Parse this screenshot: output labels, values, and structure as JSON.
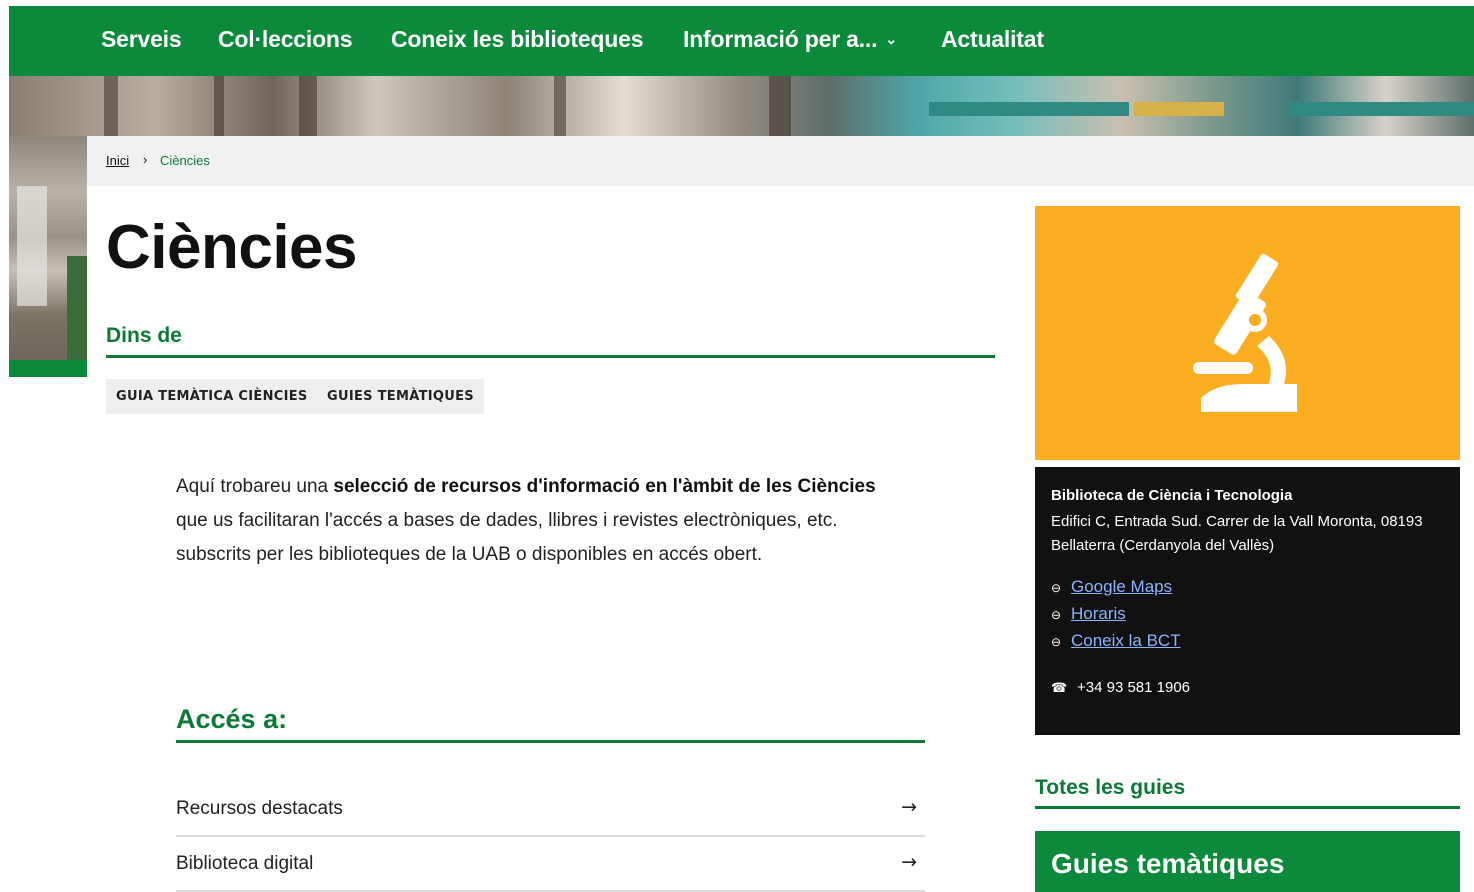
{
  "nav": {
    "items": [
      {
        "label": "Serveis"
      },
      {
        "label": "Col·leccions"
      },
      {
        "label": "Coneix les biblioteques"
      },
      {
        "label": "Informació per a..."
      },
      {
        "label": "Actualitat"
      }
    ],
    "dropdown_icon": "chevron-down-icon"
  },
  "breadcrumb": {
    "home": "Inici",
    "separator": "›",
    "current": "Ciències"
  },
  "page": {
    "title": "Ciències",
    "dins_de": "Dins de",
    "tags": [
      "GUIA TEMÀTICA CIÈNCIES",
      "GUIES TEMÀTIQUES"
    ]
  },
  "intro": {
    "part1": "Aquí trobareu una ",
    "bold1": "selecció de recursos d'informació en l'àmbit de les Ciències",
    "part2": " que us facilitaran l'accés a bases de dades, llibres i revistes electròniques, etc. subscrits per les biblioteques de la UAB o disponibles en accés obert."
  },
  "acces": {
    "title": "Accés a:",
    "items": [
      {
        "label": "Recursos destacats",
        "arrow": "→"
      },
      {
        "label": "Biblioteca digital",
        "arrow": "→"
      }
    ]
  },
  "sidebar": {
    "illustration_icon": "microscope-icon",
    "illustration_bg": "#fbae1f",
    "library_name": "Biblioteca de Ciència i Tecnologia",
    "address": "Edifici C, Entrada Sud. Carrer de la Vall Moronta, 08193 Bellaterra (Cerdanyola del Vallès)",
    "links": [
      {
        "label": "Google Maps",
        "icon": "link-icon"
      },
      {
        "label": "Horaris",
        "icon": "link-icon"
      },
      {
        "label": "Coneix la BCT",
        "icon": "link-icon"
      }
    ],
    "phone": "+34 93 581 1906",
    "phone_icon": "phone-icon",
    "totes_les_guies": "Totes les guies",
    "guies_box_title": "Guies temàtiques"
  },
  "colors": {
    "brand_green": "#0a8a3a",
    "link_blue": "#8ab4ff",
    "info_bg": "#111111"
  }
}
